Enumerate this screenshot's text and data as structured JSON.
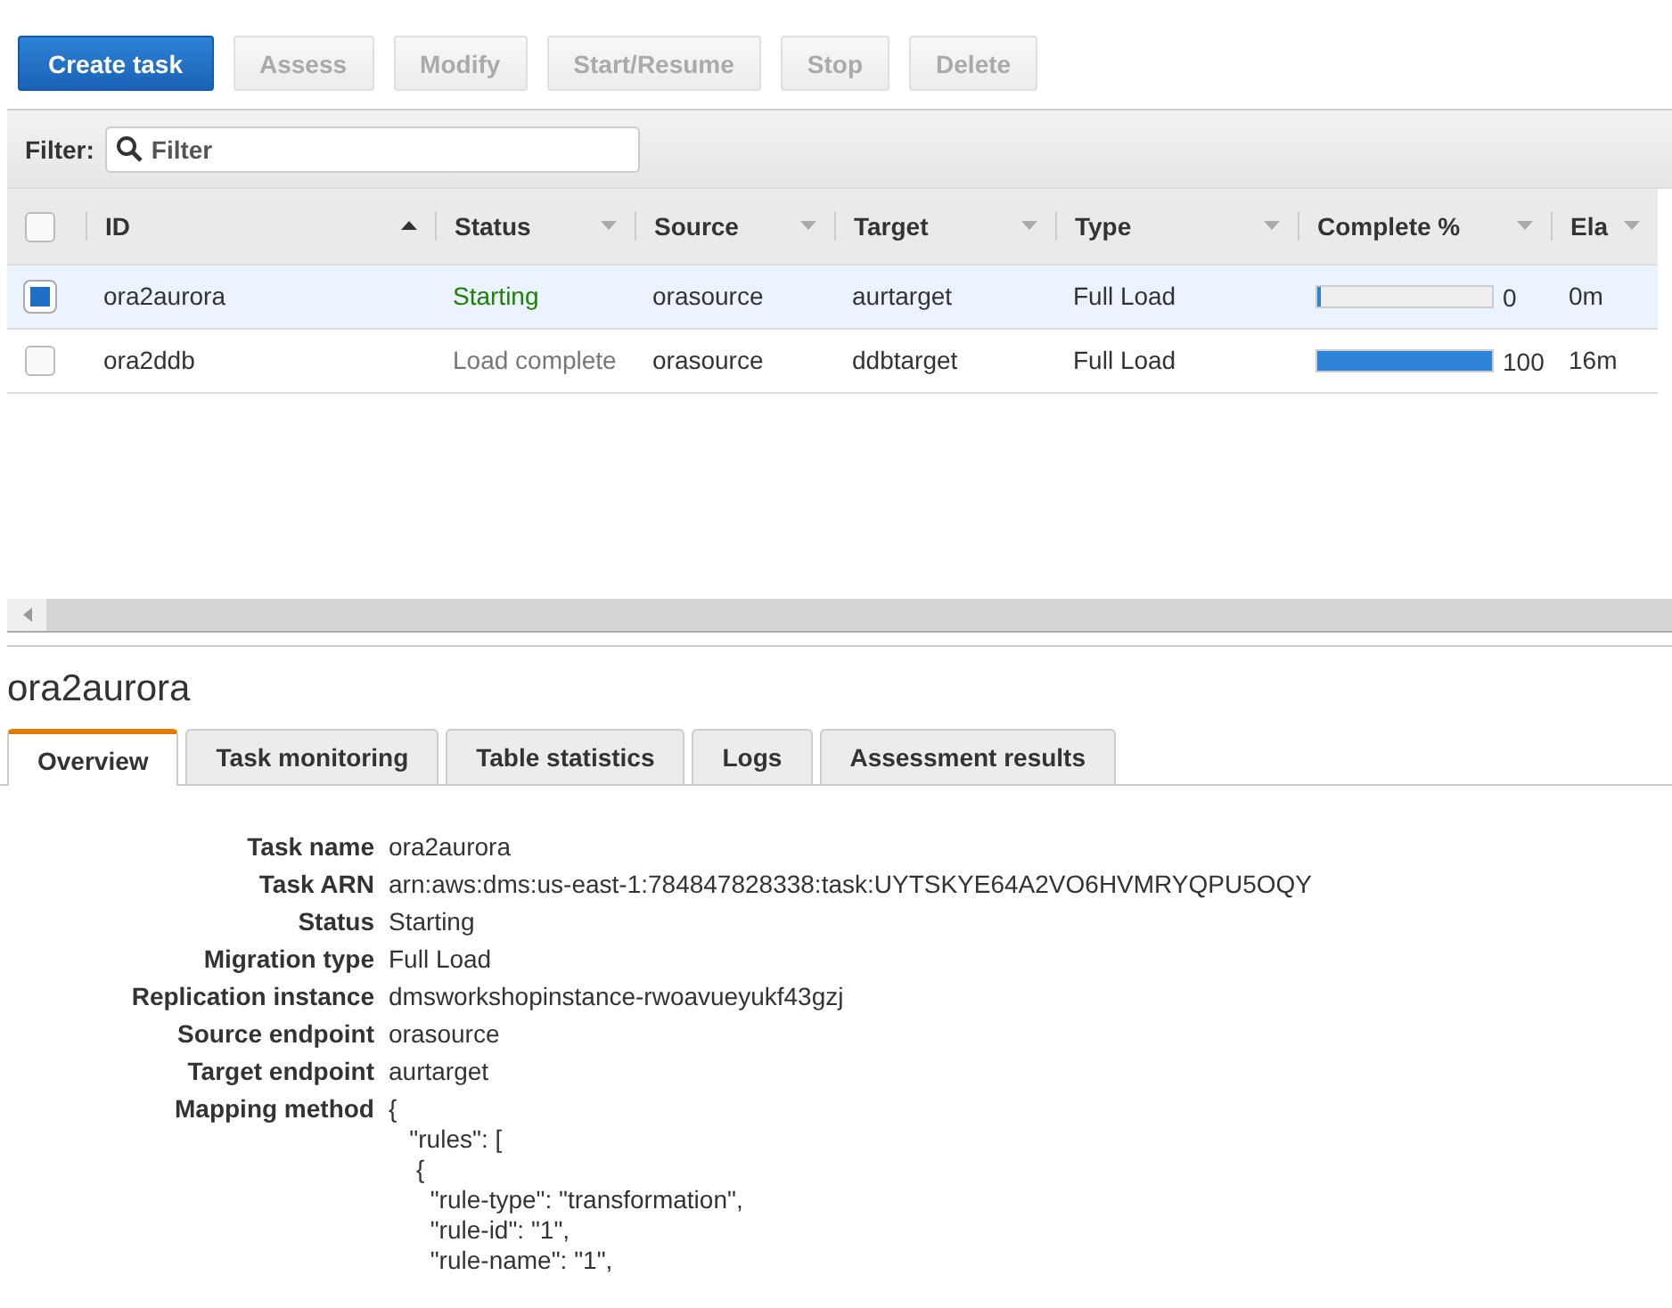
{
  "toolbar": {
    "buttons": [
      {
        "label": "Create task",
        "disabled": false,
        "primary": true
      },
      {
        "label": "Assess",
        "disabled": true,
        "primary": false
      },
      {
        "label": "Modify",
        "disabled": true,
        "primary": false
      },
      {
        "label": "Start/Resume",
        "disabled": true,
        "primary": false
      },
      {
        "label": "Stop",
        "disabled": true,
        "primary": false
      },
      {
        "label": "Delete",
        "disabled": true,
        "primary": false
      }
    ]
  },
  "filter": {
    "label": "Filter:",
    "placeholder": "Filter"
  },
  "table": {
    "select_all_checked": false,
    "columns": [
      {
        "label": "ID",
        "sorted": true
      },
      {
        "label": "Status",
        "sorted": false
      },
      {
        "label": "Source",
        "sorted": false
      },
      {
        "label": "Target",
        "sorted": false
      },
      {
        "label": "Type",
        "sorted": false
      },
      {
        "label": "Complete %",
        "sorted": false
      },
      {
        "label": "Ela",
        "sorted": false
      }
    ],
    "rows": [
      {
        "selected": true,
        "id": "ora2aurora",
        "status": "Starting",
        "color": "#1d8102",
        "source": "orasource",
        "target": "aurtarget",
        "type": "Full Load",
        "level": 0.0,
        "complete": "0",
        "column_8": "0m"
      },
      {
        "selected": false,
        "id": "ora2ddb",
        "status": "Load complete",
        "color": "#777777",
        "source": "orasource",
        "target": "ddbtarget",
        "type": "Full Load",
        "level": 1.0,
        "complete": "100",
        "column_8": "16m"
      }
    ]
  },
  "detail": {
    "title": "ora2aurora",
    "tabs": [
      {
        "label": "Overview",
        "selected": true
      },
      {
        "label": "Task monitoring",
        "selected": false
      },
      {
        "label": "Table statistics",
        "selected": false
      },
      {
        "label": "Logs",
        "selected": false
      },
      {
        "label": "Assessment results",
        "selected": false
      }
    ],
    "fields": [
      {
        "label": "Task name",
        "value": "ora2aurora"
      },
      {
        "label": "Task ARN",
        "value": "arn:aws:dms:us-east-1:784847828338:task:UYTSKYE64A2VO6HVMRYQPU5OQY"
      },
      {
        "label": "Status",
        "value": "Starting"
      },
      {
        "label": "Migration type",
        "value": "Full Load"
      },
      {
        "label": "Replication instance",
        "value": "dmsworkshopinstance-rwoavueyukf43gzj"
      },
      {
        "label": "Source endpoint",
        "value": "orasource"
      },
      {
        "label": "Target endpoint",
        "value": "aurtarget"
      },
      {
        "label": "Mapping method",
        "value": "{\n   \"rules\": [\n    {\n      \"rule-type\": \"transformation\",\n      \"rule-id\": \"1\",\n      \"rule-name\": \"1\","
      }
    ]
  }
}
